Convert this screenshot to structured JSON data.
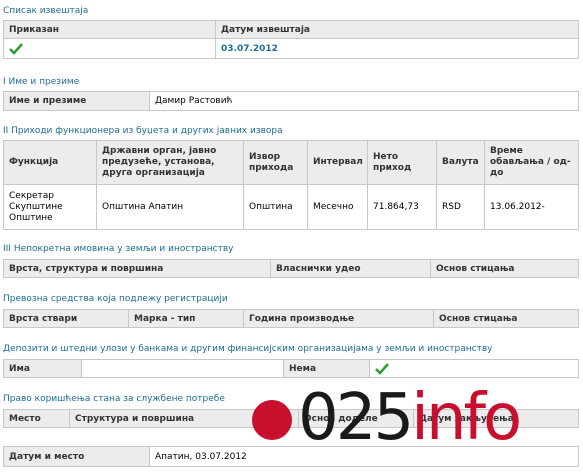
{
  "report_list": {
    "title": "Списак извештаја",
    "col_shown": "Приказан",
    "col_date": "Датум извештаја",
    "shown_icon": "check-icon",
    "date_value": "03.07.2012"
  },
  "section1": {
    "title": "I Име и презиме",
    "label": "Име и презиме",
    "value": "Дамир Растовић"
  },
  "section2": {
    "title": "II Приходи функционера из буџета и других јавних извора",
    "headers": [
      "Функција",
      "Државни орган, јавно предузеће, установа, друга организација",
      "Извор прихода",
      "Интервал",
      "Нето приход",
      "Валута",
      "Време обављања / од-до"
    ],
    "row": [
      "Секретар Скупштине Општине",
      "Општина Апатин",
      "Општина",
      "Месечно",
      "71.864,73",
      "RSD",
      "13.06.2012-"
    ]
  },
  "section3": {
    "title": "III Непокретна имовина у земљи и иностранству",
    "headers": [
      "Врста, структура и површина",
      "Власнички удео",
      "Основ стицања"
    ]
  },
  "section4": {
    "title": "Превозна средства која подлежу регистрацији",
    "headers": [
      "Врста ствари",
      "Марка - тип",
      "Година производње",
      "Основ стицања"
    ]
  },
  "section5": {
    "title": "Депозити и штедни улози у банкама и другим финансијским организацијама у земљи и иностранству",
    "label_have": "Има",
    "label_none": "Нема",
    "none_icon": "check-icon"
  },
  "section6": {
    "title": "Право коришћења стана за службене потребе",
    "headers": [
      "Место",
      "Структура и површина",
      "Основ доделе",
      "Датум закључења"
    ]
  },
  "footer": {
    "label": "Датум и место",
    "value": "Апатин, 03.07.2012"
  },
  "watermark": {
    "text_main": "025",
    "text_accent": "info",
    "accent_color": "#c8102e"
  },
  "colors": {
    "section_title": "#1c6d93",
    "header_bg": "#ececec",
    "border": "#c8c8c8",
    "check": "#2e9c2e"
  }
}
